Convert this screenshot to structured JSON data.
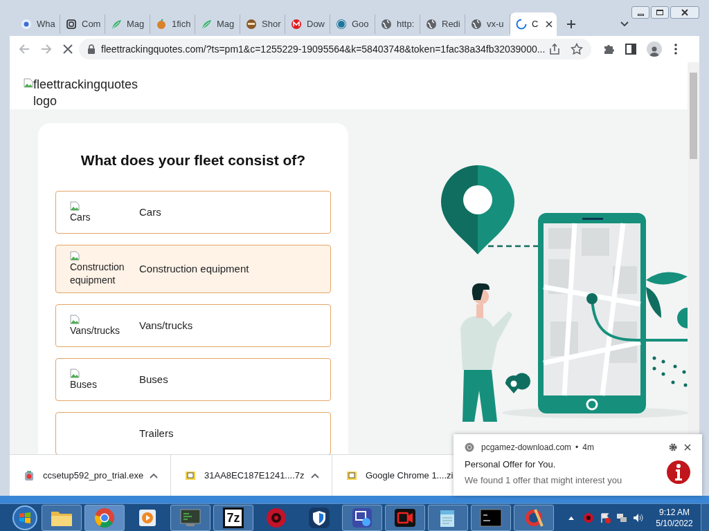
{
  "tabs": [
    {
      "title": "Wha",
      "kind": "pcircle",
      "selected": false
    },
    {
      "title": "Com",
      "kind": "square",
      "selected": false
    },
    {
      "title": "Mag",
      "kind": "leaf",
      "selected": false
    },
    {
      "title": "1fich",
      "kind": "fruit",
      "selected": false
    },
    {
      "title": "Mag",
      "kind": "leaf",
      "selected": false
    },
    {
      "title": "Shor",
      "kind": "face",
      "selected": false
    },
    {
      "title": "Dow",
      "kind": "mcircle",
      "selected": false
    },
    {
      "title": "Goo",
      "kind": "ring",
      "selected": false
    },
    {
      "title": "http:",
      "kind": "globe",
      "selected": false
    },
    {
      "title": "Redi",
      "kind": "globe",
      "selected": false
    },
    {
      "title": "vx-u",
      "kind": "globe",
      "selected": false
    },
    {
      "title": "C",
      "kind": "spinner",
      "selected": true
    }
  ],
  "address_bar": {
    "url": "fleettrackingquotes.com/?ts=pm1&c=1255229-19095564&k=58403748&token=1fac38a34fb32039000..."
  },
  "page": {
    "logo_alt": "fleettrackingquotes logo",
    "question": "What does your fleet consist of?",
    "options": [
      {
        "image_alt": "Cars",
        "label": "Cars",
        "hovered": false
      },
      {
        "image_alt": "Construction equipment",
        "label": "Construction equipment",
        "hovered": true
      },
      {
        "image_alt": "Vans/trucks",
        "label": "Vans/trucks",
        "hovered": false
      },
      {
        "image_alt": "Buses",
        "label": "Buses",
        "hovered": false
      },
      {
        "label": "Trailers",
        "hovered": false
      }
    ]
  },
  "downloads": [
    {
      "name": "ccsetup592_pro_trial.exe",
      "kind": "installer",
      "menu_caret": true
    },
    {
      "name": "31AA8EC187E1241....7z",
      "kind": "archive",
      "menu_caret": true
    },
    {
      "name": "Google Chrome 1....zi",
      "kind": "archive"
    }
  ],
  "notification": {
    "site": "pcgamez-download.com",
    "separator": "•",
    "age": "4m",
    "title": "Personal Offer for You.",
    "body": "We found 1 offer that might interest you"
  },
  "taskbar": {
    "apps": [
      {
        "kind": "folder",
        "running": true,
        "active": false
      },
      {
        "kind": "chrome",
        "running": true,
        "active": true
      },
      {
        "kind": "media",
        "running": false,
        "active": false
      },
      {
        "kind": "monitor",
        "running": true,
        "active": false
      },
      {
        "kind": "sevenzip",
        "label": "7z",
        "running": true,
        "active": false
      },
      {
        "kind": "gear",
        "running": false,
        "active": false
      },
      {
        "kind": "shield",
        "running": false,
        "active": false
      },
      {
        "kind": "capture",
        "running": true,
        "active": false
      },
      {
        "kind": "camera",
        "running": true,
        "active": false
      },
      {
        "kind": "notepad",
        "running": true,
        "active": false
      },
      {
        "kind": "terminal",
        "running": true,
        "active": false
      },
      {
        "kind": "cleaner",
        "running": true,
        "active": false
      }
    ],
    "clock": {
      "time": "9:12 AM",
      "date": "5/10/2022"
    }
  }
}
